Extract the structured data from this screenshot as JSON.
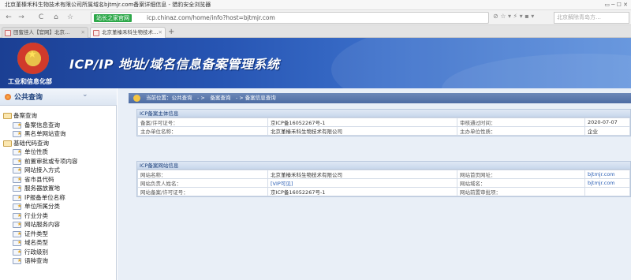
{
  "window": {
    "title": "北京堇榛禾科生物技术有限公司所属域名bjtmjr.com备案详细信息 - 猎豹安全浏览器"
  },
  "toolbar": {
    "back": "←",
    "forward": "→",
    "refresh": "C",
    "home": "⌂",
    "favorite": "☆",
    "badge": "站长之家官网",
    "url": "icp.chinaz.com/home/info?host=bjtmjr.com",
    "search_placeholder": "北京解除青岛方…"
  },
  "tabs": [
    {
      "label": "田蜜佳人【官网】北京…"
    },
    {
      "label": "北京堇榛禾科生物技术…"
    }
  ],
  "banner": {
    "dept": "工业和信息化部",
    "title": "ICP/IP 地址/域名信息备案管理系统"
  },
  "sidebar": {
    "title": "公共查询",
    "tree": [
      {
        "label": "备案查询",
        "level": 1
      },
      {
        "label": "备案信息查询",
        "level": 2
      },
      {
        "label": "黑名单网站查询",
        "level": 2
      },
      {
        "label": "基础代码查询",
        "level": 1
      },
      {
        "label": "单位性质",
        "level": 2
      },
      {
        "label": "前置审批或专项内容",
        "level": 2
      },
      {
        "label": "网站接入方式",
        "level": 2
      },
      {
        "label": "省市县代码",
        "level": 2
      },
      {
        "label": "服务器放置地",
        "level": 2
      },
      {
        "label": "IP报备单位名称",
        "level": 2
      },
      {
        "label": "单位所属分类",
        "level": 2
      },
      {
        "label": "行业分类",
        "level": 2
      },
      {
        "label": "网站服务内容",
        "level": 2
      },
      {
        "label": "证件类型",
        "level": 2
      },
      {
        "label": "域名类型",
        "level": 2
      },
      {
        "label": "行政级别",
        "level": 2
      },
      {
        "label": "语种查询",
        "level": 2
      }
    ]
  },
  "breadcrumb": {
    "text": "当前位置：公共查询　- >　备案查询　- > 备案信息查询"
  },
  "subject": {
    "header": "ICP备案主体信息",
    "rows": [
      [
        "备案/许可证号：",
        "京ICP备16052267号-1",
        "审核通过时间：",
        "2020-07-07"
      ],
      [
        "主办单位名称：",
        "北京堇榛禾科生物技术有限公司",
        "主办单位性质：",
        "企业"
      ]
    ]
  },
  "site": {
    "header": "ICP备案网站信息",
    "rows": [
      [
        "网站名称：",
        "北京堇榛禾科生物技术有限公司",
        "网站首页网址：",
        "bjtmjr.com"
      ],
      [
        "网站负责人姓名：",
        "[VIP可见]",
        "网站域名：",
        "bjtmjr.com"
      ],
      [
        "网站备案/许可证号：",
        "京ICP备16052267号-1",
        "网站前置审批项：",
        ""
      ]
    ]
  }
}
